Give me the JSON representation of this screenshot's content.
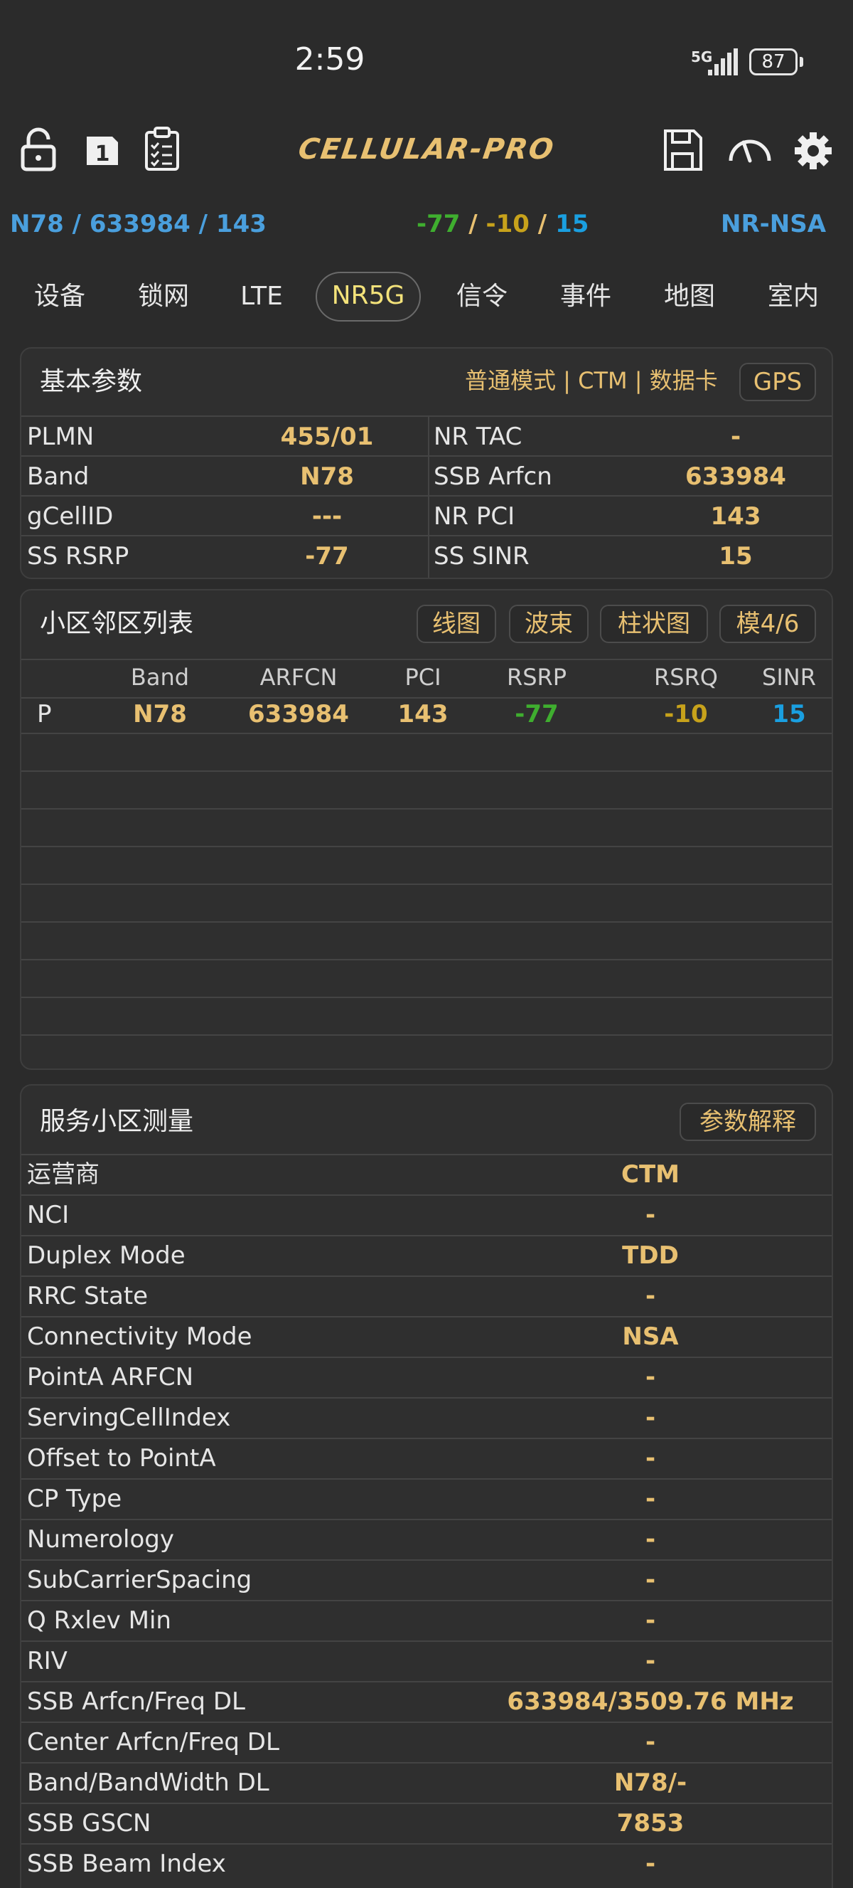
{
  "status_bar": {
    "time": "2:59",
    "network": "5G",
    "battery": "87"
  },
  "toolbar": {
    "logo": "CELLULAR-PRO",
    "sim_badge": "1"
  },
  "info_bar": {
    "band": "N78",
    "arfcn": "633984",
    "pci": "143",
    "rsrp": "-77",
    "rsrq": "-10",
    "sinr": "15",
    "sep": " / ",
    "mode": "NR-NSA"
  },
  "tabs": [
    {
      "label": "设备"
    },
    {
      "label": "锁网"
    },
    {
      "label": "LTE"
    },
    {
      "label": "NR5G"
    },
    {
      "label": "信令"
    },
    {
      "label": "事件"
    },
    {
      "label": "地图"
    },
    {
      "label": "室内"
    }
  ],
  "basic": {
    "title": "基本参数",
    "mode_text": "普通模式 | CTM | 数据卡",
    "gps": "GPS",
    "rows": [
      {
        "l1": "PLMN",
        "v1": "455/01",
        "l2": "NR TAC",
        "v2": "-"
      },
      {
        "l1": "Band",
        "v1": "N78",
        "l2": "SSB Arfcn",
        "v2": "633984"
      },
      {
        "l1": "gCellID",
        "v1": "---",
        "l2": "NR PCI",
        "v2": "143"
      },
      {
        "l1": "SS RSRP",
        "v1": "-77",
        "l2": "SS SINR",
        "v2": "15"
      }
    ]
  },
  "neighbors": {
    "title": "小区邻区列表",
    "buttons": [
      "线图",
      "波束",
      "柱状图",
      "模4/6"
    ],
    "headers": [
      "Band",
      "ARFCN",
      "PCI",
      "RSRP",
      "RSRQ",
      "SINR"
    ],
    "row": {
      "type": "P",
      "band": "N78",
      "arfcn": "633984",
      "pci": "143",
      "rsrp": "-77",
      "rsrq": "-10",
      "sinr": "15"
    }
  },
  "serving": {
    "title": "服务小区测量",
    "help": "参数解释",
    "rows": [
      {
        "label": "运营商",
        "value": "CTM"
      },
      {
        "label": "NCI",
        "value": "-"
      },
      {
        "label": "Duplex Mode",
        "value": "TDD"
      },
      {
        "label": "RRC State",
        "value": "-"
      },
      {
        "label": "Connectivity Mode",
        "value": "NSA"
      },
      {
        "label": "PointA ARFCN",
        "value": "-"
      },
      {
        "label": "ServingCellIndex",
        "value": "-"
      },
      {
        "label": "Offset to PointA",
        "value": "-"
      },
      {
        "label": "CP Type",
        "value": "-"
      },
      {
        "label": "Numerology",
        "value": "-"
      },
      {
        "label": "SubCarrierSpacing",
        "value": "-"
      },
      {
        "label": "Q Rxlev Min",
        "value": "-"
      },
      {
        "label": "RIV",
        "value": "-"
      },
      {
        "label": "SSB Arfcn/Freq DL",
        "value": "633984/3509.76 MHz"
      },
      {
        "label": "Center Arfcn/Freq DL",
        "value": "-"
      },
      {
        "label": "Band/BandWidth DL",
        "value": "N78/-"
      },
      {
        "label": "SSB GSCN",
        "value": "7853"
      },
      {
        "label": "SSB Beam Index",
        "value": "-"
      }
    ]
  },
  "colors": {
    "accent": "#e8c071",
    "blue": "#4a9fdd",
    "green": "#3fae2f",
    "yellow": "#c7a21b",
    "cyan": "#1a9fe0"
  }
}
